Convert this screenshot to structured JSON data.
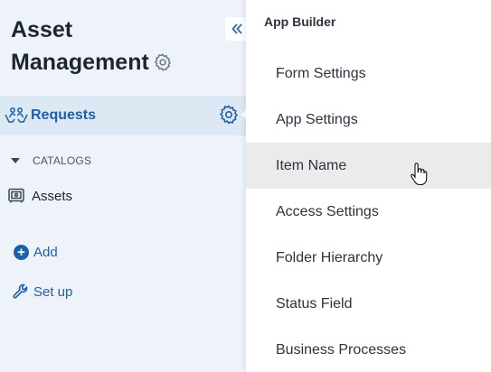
{
  "sidebar": {
    "title_line1": "Asset",
    "title_line2": "Management",
    "title_gear_icon": "gear-icon",
    "collapse_icon": "double-chevron-left-icon",
    "requests": {
      "label": "Requests",
      "icon": "hands-people-icon",
      "gear_icon": "gear-icon"
    },
    "catalogs_label": "CATALOGS",
    "assets": {
      "label": "Assets",
      "icon": "safe-icon"
    },
    "add_label": "Add",
    "setup_label": "Set up",
    "accent_color": "#1f5fa8"
  },
  "menu": {
    "header": "App Builder",
    "items": [
      {
        "label": "Form Settings"
      },
      {
        "label": "App Settings"
      },
      {
        "label": "Item Name",
        "hovered": true
      },
      {
        "label": "Access Settings"
      },
      {
        "label": "Folder Hierarchy"
      },
      {
        "label": "Status Field"
      },
      {
        "label": "Business Processes"
      }
    ]
  }
}
